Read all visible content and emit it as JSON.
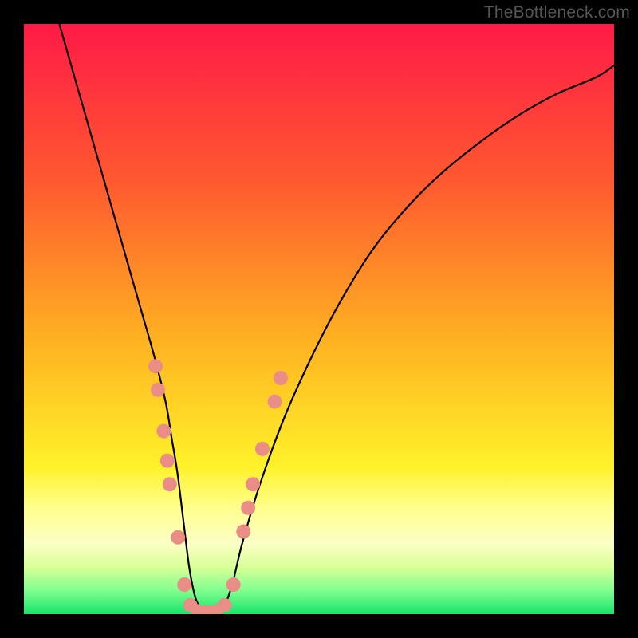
{
  "watermark": "TheBottleneck.com",
  "chart_data": {
    "type": "line",
    "title": "",
    "xlabel": "",
    "ylabel": "",
    "xlim": [
      0,
      100
    ],
    "ylim": [
      0,
      100
    ],
    "background_gradient": {
      "stops": [
        {
          "pct": 0,
          "color": "#ff1a47"
        },
        {
          "pct": 27,
          "color": "#ff5a2f"
        },
        {
          "pct": 54,
          "color": "#ffb321"
        },
        {
          "pct": 75,
          "color": "#fff22a"
        },
        {
          "pct": 82,
          "color": "#ffff8c"
        },
        {
          "pct": 88,
          "color": "#fcffc5"
        },
        {
          "pct": 92,
          "color": "#d9ff99"
        },
        {
          "pct": 96,
          "color": "#7fff8e"
        },
        {
          "pct": 100,
          "color": "#19e36b"
        }
      ]
    },
    "series": [
      {
        "name": "bottleneck-curve",
        "color": "#000000",
        "stroke_width": 2.2,
        "x": [
          6,
          8,
          10,
          12,
          14,
          16,
          18,
          20,
          22,
          24,
          25,
          26,
          27,
          28,
          29,
          30,
          31,
          33,
          35,
          37,
          40,
          44,
          48,
          52,
          56,
          60,
          65,
          70,
          76,
          83,
          90,
          97,
          100
        ],
        "y_pct": [
          100,
          93,
          86,
          79,
          72,
          65,
          58,
          51,
          44,
          36,
          30,
          24,
          16,
          8,
          3,
          1,
          0,
          0,
          4,
          12,
          22,
          33,
          42,
          50,
          57,
          63,
          69,
          74,
          79,
          84,
          88,
          91,
          93
        ]
      }
    ],
    "markers": {
      "name": "highlight-dots",
      "color": "#e98d86",
      "radius": 9,
      "points": [
        {
          "x": 22.3,
          "y_pct": 42
        },
        {
          "x": 22.7,
          "y_pct": 38
        },
        {
          "x": 23.7,
          "y_pct": 31
        },
        {
          "x": 24.3,
          "y_pct": 26
        },
        {
          "x": 24.7,
          "y_pct": 22
        },
        {
          "x": 26.1,
          "y_pct": 13
        },
        {
          "x": 27.2,
          "y_pct": 5
        },
        {
          "x": 28.2,
          "y_pct": 1.5
        },
        {
          "x": 29.5,
          "y_pct": 0.5
        },
        {
          "x": 31.0,
          "y_pct": 0.3
        },
        {
          "x": 32.5,
          "y_pct": 0.5
        },
        {
          "x": 34.0,
          "y_pct": 1.5
        },
        {
          "x": 35.5,
          "y_pct": 5
        },
        {
          "x": 37.2,
          "y_pct": 14
        },
        {
          "x": 38.0,
          "y_pct": 18
        },
        {
          "x": 38.8,
          "y_pct": 22
        },
        {
          "x": 40.4,
          "y_pct": 28
        },
        {
          "x": 42.5,
          "y_pct": 36
        },
        {
          "x": 43.5,
          "y_pct": 40
        }
      ]
    }
  }
}
